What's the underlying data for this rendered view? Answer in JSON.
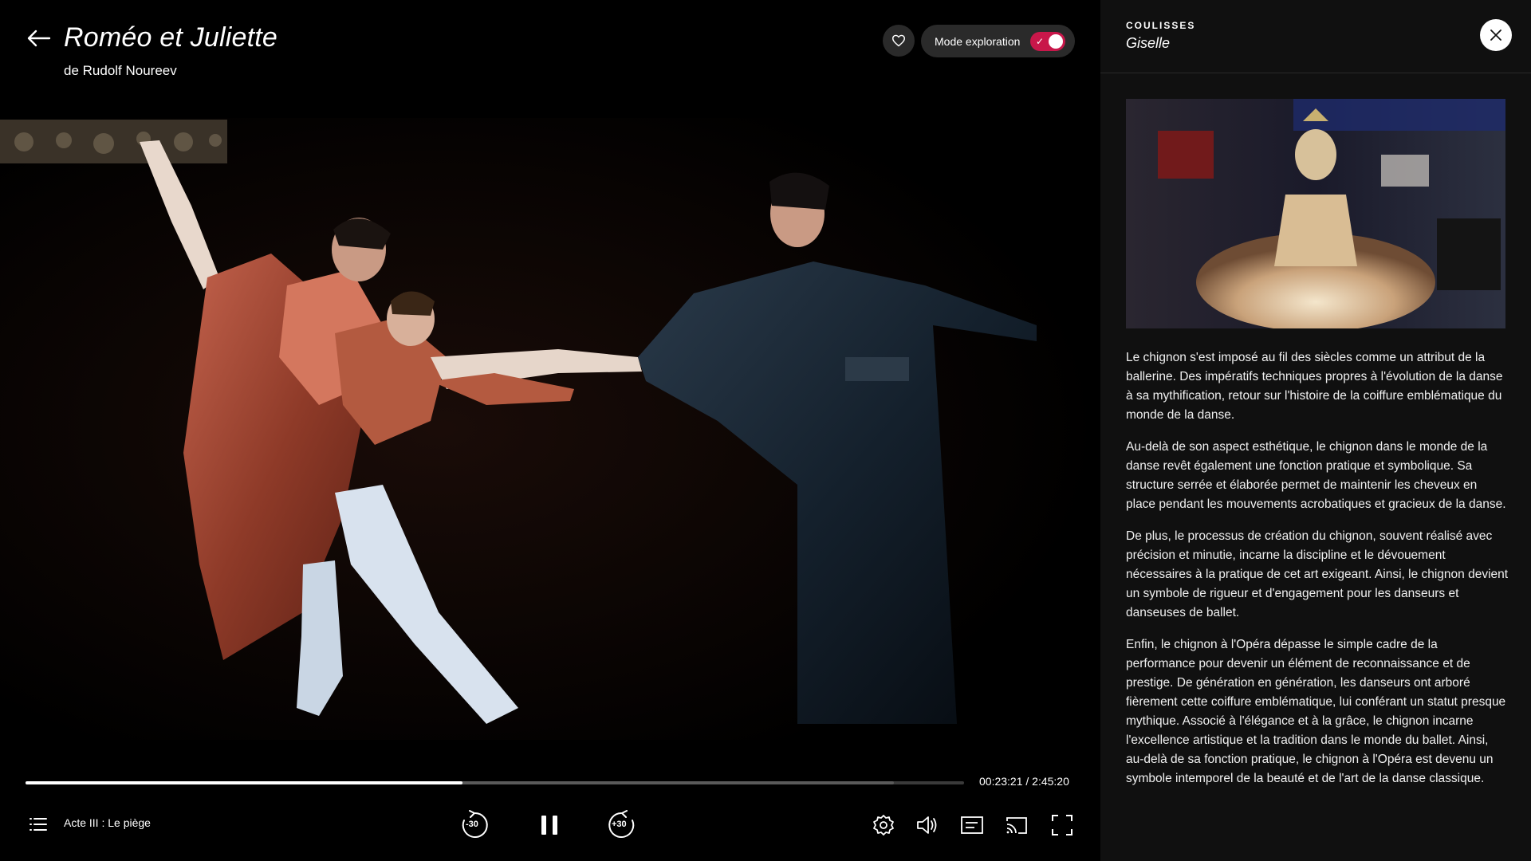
{
  "player": {
    "title": "Roméo et Juliette",
    "subtitle": "de Rudolf Noureev",
    "favorite_icon": "heart-icon",
    "explore_mode": {
      "label": "Mode exploration",
      "enabled": true
    },
    "progress": {
      "played_fraction": 0.466,
      "buffered_fraction": 0.925
    },
    "time": "00:23:21 / 2:45:20",
    "chapter": "Acte III : Le piège",
    "controls": {
      "rewind": "-30",
      "forward": "+30",
      "play_state": "playing"
    }
  },
  "panel": {
    "eyebrow": "COULISSES",
    "title": "Giselle",
    "paragraphs": [
      "Le chignon s'est imposé au fil des siècles comme un attribut de la ballerine. Des impératifs techniques propres à l'évolution de la danse à sa mythification, retour sur l'histoire de la coiffure emblématique du monde de la danse.",
      "Au-delà de son aspect esthétique, le chignon dans le monde de la danse revêt également une fonction pratique et symbolique. Sa structure serrée et élaborée permet de maintenir les cheveux en place pendant les mouvements acrobatiques et gracieux de la danse.",
      "De plus, le processus de création du chignon, souvent réalisé avec précision et minutie, incarne la discipline et le dévouement nécessaires à la pratique de cet art exigeant. Ainsi, le chignon devient un symbole de rigueur et d'engagement pour les danseurs et danseuses de ballet.",
      "Enfin, le chignon à l'Opéra dépasse le simple cadre de la performance pour devenir un élément de reconnaissance et de prestige. De génération en génération, les danseurs ont arboré fièrement cette coiffure emblématique, lui conférant un statut presque mythique. Associé à l'élégance et à la grâce, le chignon incarne l'excellence artistique et la tradition dans le monde du ballet. Ainsi, au-delà de sa fonction pratique, le chignon à l'Opéra est devenu un symbole intemporel de la beauté et de l'art de la danse classique."
    ]
  },
  "colors": {
    "accent": "#c8174a",
    "panel_bg": "#101010",
    "pill_bg": "#2a2a2a"
  }
}
